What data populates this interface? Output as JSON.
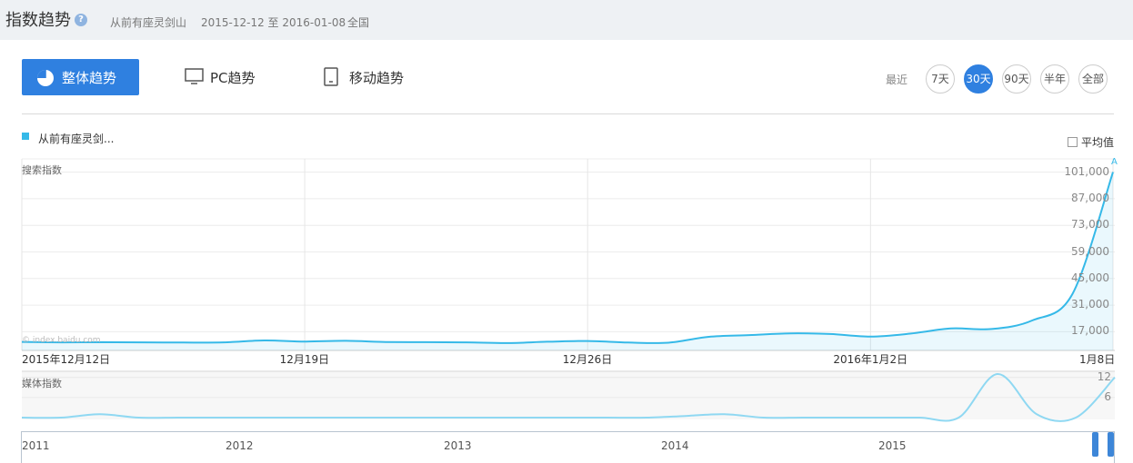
{
  "header": {
    "title": "指数趋势",
    "help_icon": "question-icon",
    "keyword": "从前有座灵剑山",
    "date_range": "2015-12-12 至 2016-01-08",
    "region": "全国"
  },
  "tabs": {
    "overall": "整体趋势",
    "pc": "PC趋势",
    "mobile": "移动趋势"
  },
  "range": {
    "recent_label": "最近",
    "options": [
      "7天",
      "30天",
      "90天",
      "半年",
      "全部"
    ],
    "active": "30天"
  },
  "legend": {
    "series_name": "从前有座灵剑...",
    "average_label": "平均值"
  },
  "colors": {
    "accent": "#2f80e0",
    "series": "#35b9e8",
    "media_series": "#8fd8f2"
  },
  "watermark": "© index.baidu.com",
  "chart_data": [
    {
      "type": "area",
      "title": "搜索指数",
      "ylim": [
        10000,
        108000
      ],
      "yticks": [
        "17,000",
        "31,000",
        "45,000",
        "59,000",
        "73,000",
        "87,000",
        "101,000"
      ],
      "ytick_values": [
        17000,
        31000,
        45000,
        59000,
        73000,
        87000,
        101000
      ],
      "xtick_labels": [
        "2015年12月12日",
        "12月19日",
        "12月26日",
        "2016年1月2日",
        "1月8日"
      ],
      "xtick_index": [
        0,
        7,
        14,
        21,
        27
      ],
      "annotation": "A",
      "grid": true,
      "series": [
        {
          "name": "从前有座灵剑...",
          "values": [
            11600,
            11400,
            11500,
            11400,
            11300,
            11400,
            12400,
            11800,
            12200,
            11600,
            11500,
            11400,
            11000,
            11700,
            12100,
            11300,
            11200,
            14300,
            15200,
            16100,
            15800,
            14400,
            16000,
            18700,
            18400,
            22900,
            37000,
            101000
          ]
        }
      ]
    },
    {
      "type": "line",
      "title": "媒体指数",
      "ylim": [
        0,
        13
      ],
      "yticks": [
        "6",
        "12"
      ],
      "ytick_values": [
        6,
        12
      ],
      "grid": true,
      "series": [
        {
          "name": "媒体指数",
          "values": [
            0,
            0,
            1,
            0,
            0,
            0,
            0,
            0,
            0,
            0,
            0,
            0,
            0,
            0,
            0,
            0,
            0,
            0.5,
            1,
            0,
            0,
            0,
            0,
            0,
            0,
            13,
            1,
            0,
            12
          ]
        }
      ]
    }
  ],
  "navigator": {
    "years": [
      "2011",
      "2012",
      "2013",
      "2014",
      "2015"
    ]
  }
}
